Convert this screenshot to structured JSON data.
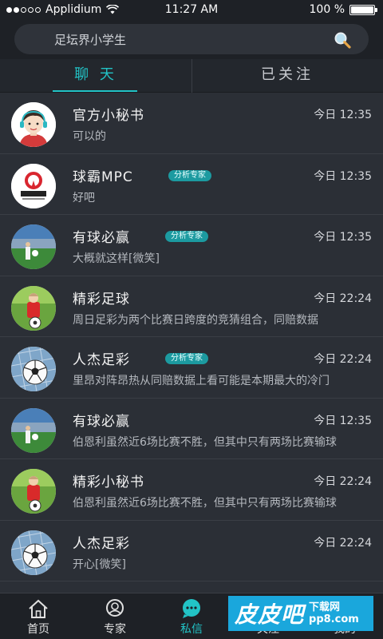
{
  "status_bar": {
    "carrier": "Applidium",
    "time": "11:27 AM",
    "battery": "100 %",
    "battery_level": 1.0
  },
  "search": {
    "text": "足坛界小学生"
  },
  "tabs": [
    {
      "label": "聊 天",
      "active": true
    },
    {
      "label": "已关注",
      "active": false
    }
  ],
  "conversations": [
    {
      "name": "官方小秘书",
      "badge": "",
      "time": "今日 12:35",
      "message": "可以的",
      "avatar": "secretary-avatar"
    },
    {
      "name": "球霸MPC",
      "badge": "分析专家",
      "time": "今日 12:35",
      "message": "好吧",
      "avatar": "renjie-logo-avatar"
    },
    {
      "name": "有球必赢",
      "badge": "分析专家",
      "time": "今日 12:35",
      "message": "大概就这样[微笑]",
      "avatar": "stadium-avatar"
    },
    {
      "name": "精彩足球",
      "badge": "",
      "time": "今日 22:24",
      "message": "周日足彩为两个比赛日跨度的竞猜组合，同赔数据",
      "avatar": "child-player-avatar"
    },
    {
      "name": "人杰足彩",
      "badge": "分析专家",
      "time": "今日 22:24",
      "message": "里昂对阵昂热从同赔数据上看可能是本期最大的冷门",
      "avatar": "soccer-ball-net-avatar"
    },
    {
      "name": "有球必赢",
      "badge": "",
      "time": "今日 12:35",
      "message": "伯恩利虽然近6场比赛不胜，但其中只有两场比赛输球",
      "avatar": "stadium-avatar"
    },
    {
      "name": "精彩小秘书",
      "badge": "",
      "time": "今日 22:24",
      "message": "伯恩利虽然近6场比赛不胜，但其中只有两场比赛输球",
      "avatar": "child-player-avatar"
    },
    {
      "name": "人杰足彩",
      "badge": "",
      "time": "今日 22:24",
      "message": "开心[微笑]",
      "avatar": "soccer-ball-net-avatar"
    }
  ],
  "tabbar": [
    {
      "label": "首页",
      "icon": "home-icon",
      "active": false
    },
    {
      "label": "专家",
      "icon": "expert-icon",
      "active": false
    },
    {
      "label": "私信",
      "icon": "message-icon",
      "active": true
    },
    {
      "label": "关注",
      "icon": "follow-icon",
      "active": false
    },
    {
      "label": "我的",
      "icon": "profile-icon",
      "active": false
    }
  ],
  "watermark": {
    "main": "皮皮吧",
    "top": "下载网",
    "bottom": "pp8.com"
  },
  "colors": {
    "accent": "#22c3c6",
    "background": "#2b2f36",
    "bar": "#1e2126"
  }
}
